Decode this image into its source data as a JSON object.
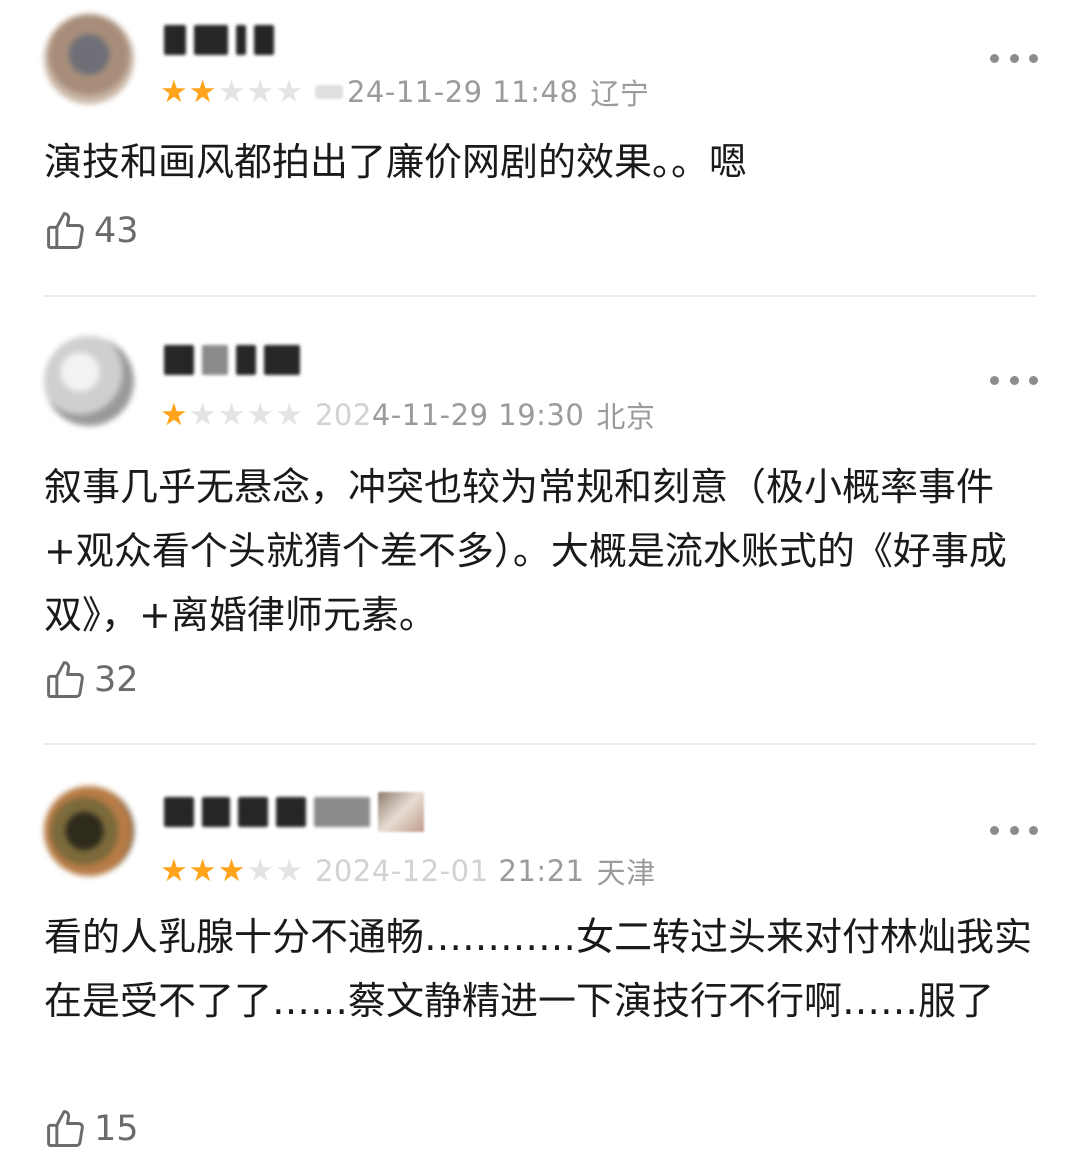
{
  "reviews": [
    {
      "rating": 2,
      "datetime": "24-11-29 11:48",
      "location": "辽宁",
      "text": "演技和画风都拍出了廉价网剧的效果。。嗯",
      "likes": "43"
    },
    {
      "rating": 1,
      "datetime_dim": "202",
      "datetime": "4-11-29 19:30",
      "location": "北京",
      "text": "叙事几乎无悬念，冲突也较为常规和刻意（极小概率事件+观众看个头就猜个差不多）。大概是流水账式的《好事成双》，+离婚律师元素。",
      "likes": "32"
    },
    {
      "rating": 3,
      "datetime_dim": "2024-12-01",
      "datetime": "21:21",
      "location": "天津",
      "text": "看的人乳腺十分不通畅…………女二转过头来对付林灿我实在是受不了了……蔡文静精进一下演技行不行啊……服了",
      "likes": "15"
    }
  ],
  "icons": {
    "like": "thumbs-up-outline-icon",
    "more": "more-horizontal-icon",
    "star": "star-icon"
  },
  "colors": {
    "star_on": "#ffa41b",
    "star_off": "#e4e4e4",
    "meta_text": "#9b9b9b",
    "divider": "#ececec"
  }
}
